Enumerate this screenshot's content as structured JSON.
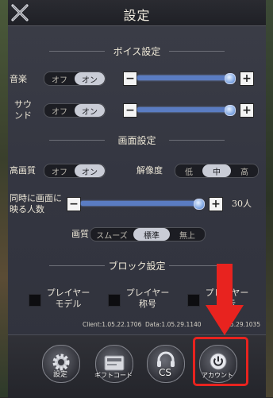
{
  "header": {
    "title": "設定"
  },
  "voice": {
    "heading": "ボイス設定",
    "music_label": "音楽",
    "sound_label": "サウンド",
    "off": "オフ",
    "on": "オン",
    "music_on": true,
    "sound_on": true,
    "music_level": 0.96,
    "sound_level": 0.96,
    "minus": "−",
    "plus": "+"
  },
  "display": {
    "heading": "画面設定",
    "hq_label": "高画質",
    "hq_off": "オフ",
    "hq_on": "オン",
    "res_label": "解像度",
    "res_options": [
      "低",
      "中",
      "高"
    ],
    "res_selected": "中",
    "people_label": "同時に画面に映る人数",
    "people_value": "30人",
    "quality_label": "画質",
    "quality_options": [
      "スムーズ",
      "標準",
      "無上"
    ],
    "quality_selected": "標準"
  },
  "block": {
    "heading": "ブロック設定",
    "items": [
      "プレイヤーモデル",
      "プレイヤー称号",
      "プレイヤー表示"
    ]
  },
  "versions": {
    "client": "Client:1.05.22.1706",
    "data": "Data:1.05.29.1140",
    "third": "1.05.29.1035"
  },
  "bottom": {
    "settings": "設定",
    "gift": "ギフトコード",
    "cs": "CS",
    "account": "アカウント"
  },
  "colors": {
    "highlight": "#e8231f",
    "slider": "#5a7cc2"
  }
}
